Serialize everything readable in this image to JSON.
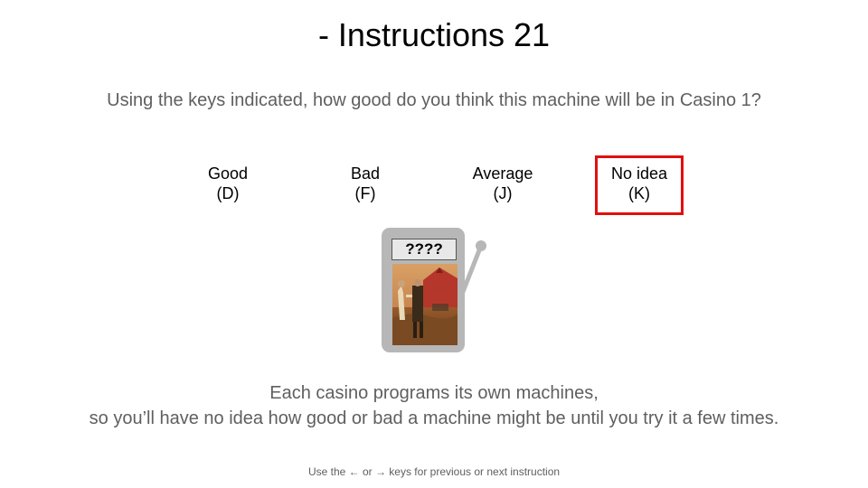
{
  "slide": {
    "title": "- Instructions 21",
    "question": "Using the keys indicated, how good do you think this machine will be in Casino 1?"
  },
  "options": [
    {
      "label": "Good",
      "key": "(D)",
      "selected": false
    },
    {
      "label": "Bad",
      "key": "(F)",
      "selected": false
    },
    {
      "label": "Average",
      "key": "(J)",
      "selected": false
    },
    {
      "label": "No idea",
      "key": "(K)",
      "selected": true
    }
  ],
  "machine": {
    "display_text": "????",
    "image_icon": "painting-icon",
    "lever_icon": "lever-icon"
  },
  "explanation": {
    "line1": "Each casino programs its own machines,",
    "line2": "so you’ll have no idea how good or bad a machine might be until you try it a few times."
  },
  "footer": {
    "hint": "Use the ← or → keys for previous or next instruction"
  },
  "colors": {
    "selection_border": "#e01010",
    "machine_body": "#b7b7b7",
    "secondary_text": "#5f5f5f"
  }
}
